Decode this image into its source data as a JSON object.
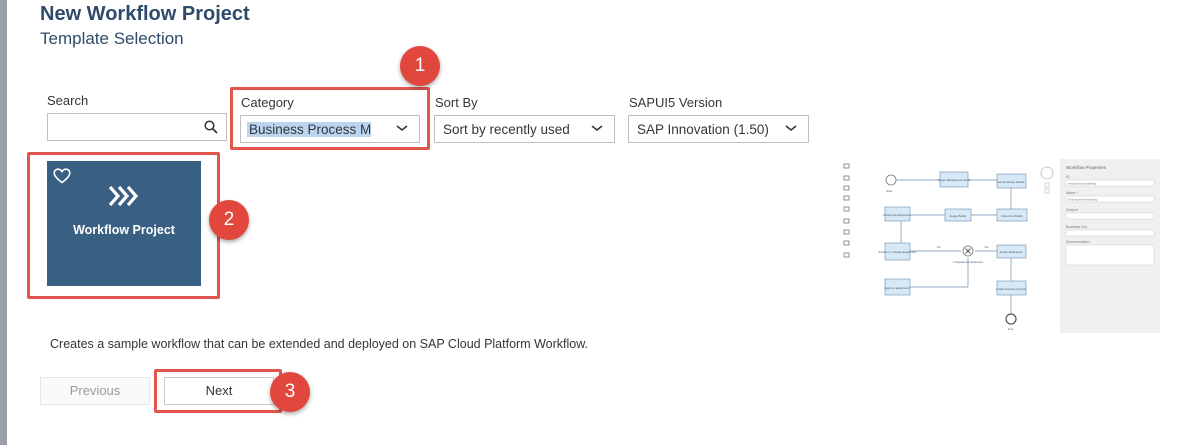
{
  "header": {
    "title": "New Workflow Project",
    "subtitle": "Template Selection"
  },
  "filters": {
    "search_label": "Search",
    "search_value": "",
    "category_label": "Category",
    "category_value": "Business Process Man",
    "sort_label": "Sort By",
    "sort_value": "Sort by recently used",
    "version_label": "SAPUI5 Version",
    "version_value": "SAP Innovation (1.50)"
  },
  "template": {
    "name": "Workflow Project",
    "description": "Creates a sample workflow that can be extended and deployed on SAP Cloud Platform Workflow."
  },
  "preview": {
    "panel_title": "Workflow Properties",
    "field_id": "ID",
    "field_id_value": "employeeonboarding",
    "field_name": "Name *",
    "field_name_value": "EmployeeOnboarding",
    "field_subject": "Subject",
    "field_business_key": "Business Key",
    "field_documentation": "Documentation",
    "nodes": {
      "start": "Start",
      "trigger": "Trigger Background Check",
      "get_details": "Get Employee Details",
      "determine": "Determine Equipment",
      "assign_buddy": "Assign Buddy",
      "undertone": "Undertone Buddy",
      "confirm": "Confirm or Change Equipment",
      "gateway": "Is Equipment Approved",
      "assign_workspace": "Assign Workspace",
      "approve": "Approve Equipment",
      "create_success": "Create Success Context",
      "end": "End",
      "no": "No",
      "yes": "Yes"
    }
  },
  "actions": {
    "previous": "Previous",
    "next": "Next"
  },
  "callouts": [
    "1",
    "2",
    "3"
  ],
  "colors": {
    "accent": "#396082",
    "title": "#2f4a6b",
    "callout": "#e2473d",
    "highlight": "#e0564d"
  }
}
